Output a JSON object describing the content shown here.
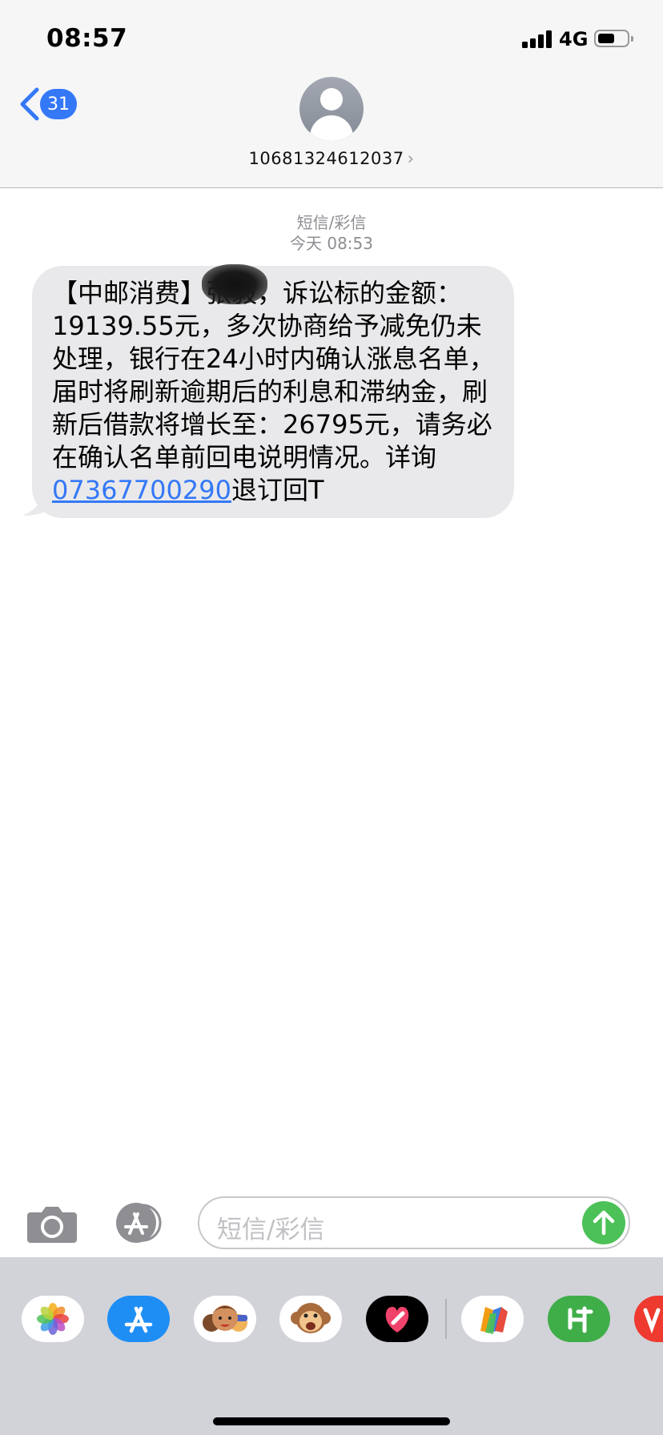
{
  "status": {
    "time": "08:57",
    "network": "4G"
  },
  "header": {
    "back_count": "31",
    "contact": "10681324612037",
    "chevron": "›"
  },
  "thread": {
    "service": "短信/彩信",
    "timestamp": "今天 08:53",
    "message": {
      "text": "【中邮消费】张毅，诉讼标的金额：19139.55元，多次协商给予减免仍未处理，银行在24小时内确认涨息名单，届时将刷新逾期后的利息和滞纳金，刷新后借款将增长至：26795元，请务必在确认名单前回电说明情况。详询",
      "phone_link": "07367700290",
      "suffix": "退订回T"
    }
  },
  "input": {
    "placeholder": "短信/彩信"
  },
  "drawer_apps": [
    "photos-icon",
    "app-store-icon",
    "memoji-icon",
    "animoji-icon",
    "digital-touch-icon",
    "books-app-icon",
    "green-app-icon",
    "red-app-icon"
  ],
  "colors": {
    "accent": "#3478f6",
    "send": "#4cc157",
    "bubble": "#e9e9eb"
  }
}
